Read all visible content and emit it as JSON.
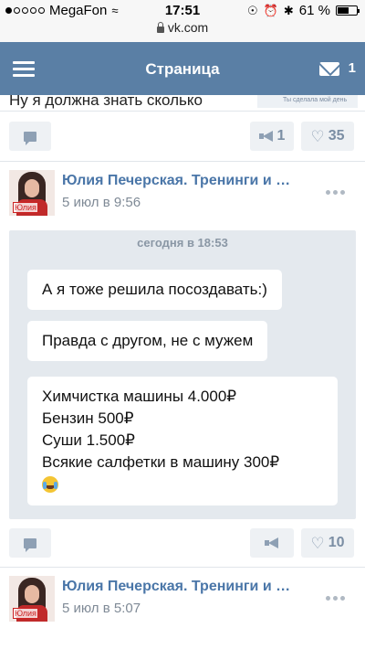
{
  "status_bar": {
    "carrier": "MegaFon",
    "time": "17:51",
    "battery": "61 %"
  },
  "browser": {
    "url": "vk.com"
  },
  "header": {
    "title": "Страница",
    "messages_count": "1"
  },
  "previous_post": {
    "text_fragment": "Ну я должна знать сколько",
    "thumb_text": "Ты сделала мой день"
  },
  "previous_post_actions": {
    "reposts": "1",
    "likes": "35"
  },
  "post": {
    "author": "Юлия Печерская. Тренинги и …",
    "date": "5 июл в 9:56",
    "avatar_caption": "Юлия",
    "chat": {
      "timestamp": "сегодня в 18:53",
      "messages": [
        "А я тоже решила посоздавать:)",
        "Правда с другом, не с мужем"
      ],
      "list_lines": [
        "Химчистка машины 4.000₽",
        "Бензин 500₽",
        "Суши 1.500₽",
        "Всякие салфетки в машину 300₽"
      ]
    },
    "actions": {
      "likes": "10"
    }
  },
  "next_post": {
    "author": "Юлия Печерская. Тренинги и …",
    "date": "5 июл в 5:07",
    "avatar_caption": "Юлия"
  },
  "icons": {
    "menu": "hamburger-icon",
    "messages": "mail-icon",
    "comment": "comment-icon",
    "repost": "megaphone-icon",
    "like": "heart-icon",
    "more": "more-dots-icon"
  },
  "colors": {
    "header": "#5a7fa5",
    "link": "#4a76a8",
    "chat_background": "#e4e9ee"
  }
}
